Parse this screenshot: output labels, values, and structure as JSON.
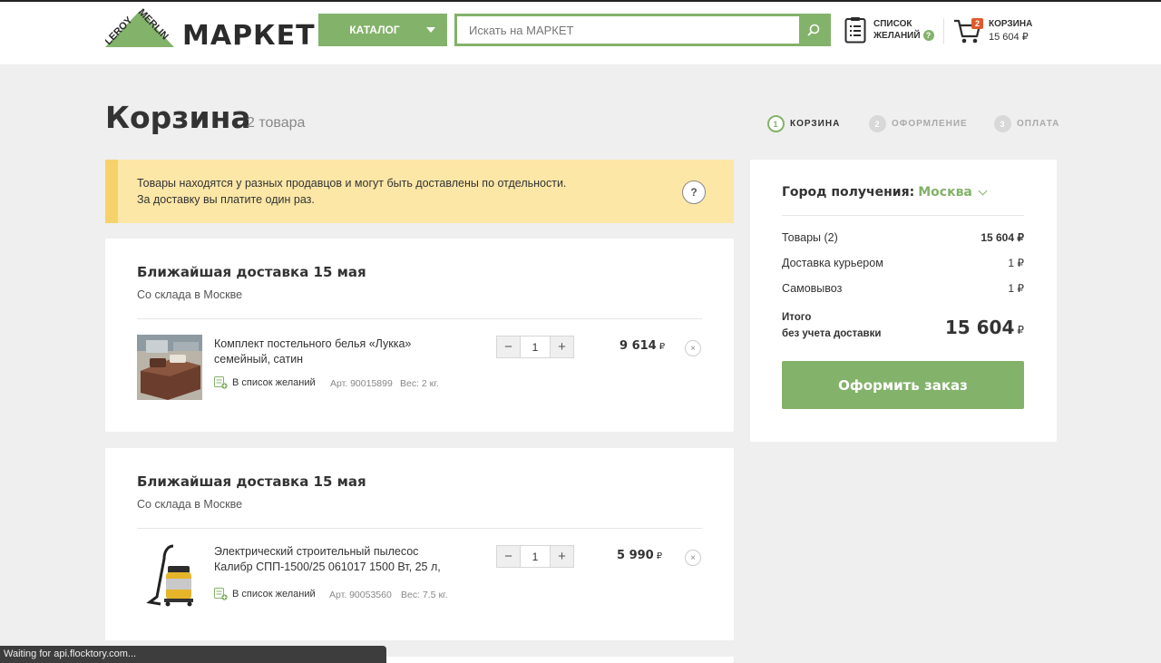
{
  "header": {
    "brand_logo_text": "LEROY MERLIN",
    "brand_name": "МАРКЕТ",
    "catalog_label": "КАТАЛОГ",
    "search_placeholder": "Искать на МАРКЕТ",
    "wishlist_line1": "СПИСОК",
    "wishlist_line2": "ЖЕЛАНИЙ",
    "wishlist_help": "?",
    "cart_label": "КОРЗИНА",
    "cart_total": "15 604 ₽",
    "cart_count": "2",
    "brand_color": "#83b26a"
  },
  "page": {
    "title": "Корзина",
    "count": "2 товара",
    "steps": [
      {
        "num": "1",
        "label": "КОРЗИНА",
        "active": true
      },
      {
        "num": "2",
        "label": "ОФОРМЛЕНИЕ",
        "active": false
      },
      {
        "num": "3",
        "label": "ОПЛАТА",
        "active": false
      }
    ]
  },
  "notice": {
    "line1": "Товары находятся у разных продавцов и могут быть доставлены по отдельности.",
    "line2": "За доставку вы платите один раз.",
    "help": "?"
  },
  "shipments": [
    {
      "title": "Ближайшая доставка 15 мая",
      "subtitle": "Со склада в Москве",
      "item": {
        "name_line1": "Комплект постельного белья «Лукка»",
        "name_line2": "семейный, сатин",
        "wishlist_label": "В список желаний",
        "article": "Арт. 90015899",
        "weight": "Вес: 2 кг.",
        "qty": "1",
        "minus": "−",
        "plus": "+",
        "price": "9 614",
        "currency": "₽",
        "remove": "×"
      }
    },
    {
      "title": "Ближайшая доставка 15 мая",
      "subtitle": "Со склада в Москве",
      "item": {
        "name_line1": "Электрический строительный пылесос",
        "name_line2": "Калибр СПП-1500/25 061017 1500 Вт, 25 л,",
        "wishlist_label": "В список желаний",
        "article": "Арт. 90053560",
        "weight": "Вес: 7.5 кг.",
        "qty": "1",
        "minus": "−",
        "plus": "+",
        "price": "5 990",
        "currency": "₽",
        "remove": "×"
      }
    }
  ],
  "summary": {
    "city_label": "Город получения:",
    "city_value": "Москва",
    "rows": [
      {
        "label": "Товары (2)",
        "value": "15 604 ₽"
      },
      {
        "label": "Доставка курьером",
        "value": "1 ₽"
      },
      {
        "label": "Самовывоз",
        "value": "1 ₽"
      }
    ],
    "total_label_line1": "Итого",
    "total_label_line2": "без учета доставки",
    "total_value": "15 604",
    "total_currency": "₽",
    "order_button": "Оформить заказ"
  },
  "status_bar": "Waiting for api.flocktory.com..."
}
